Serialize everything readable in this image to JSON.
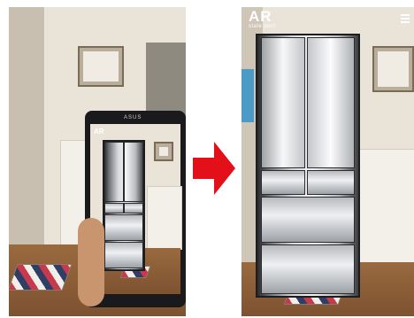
{
  "left_panel": {
    "phone_brand": "ASUS",
    "in_screen_logo": "AR"
  },
  "right_panel": {
    "logo_main": "AR",
    "logo_sub": "stale post",
    "menu_icon": "hamburger-menu-icon"
  },
  "arrow": {
    "icon": "right-arrow-icon",
    "color": "#e3101a"
  }
}
